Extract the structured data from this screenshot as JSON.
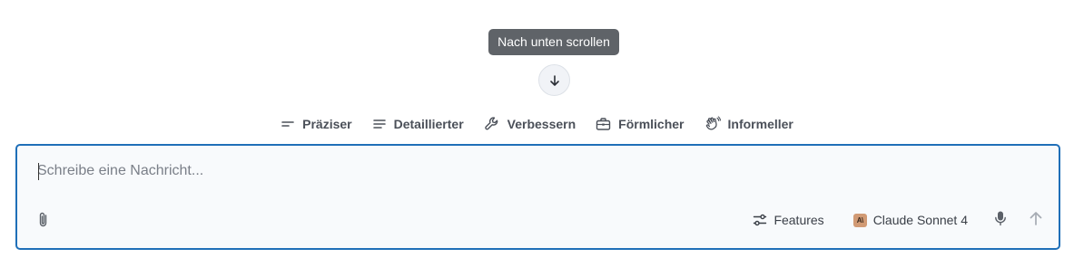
{
  "tooltip": {
    "text": "Nach unten scrollen"
  },
  "scroll_button": {
    "icon": "arrow-down-icon"
  },
  "suggestions": [
    {
      "label": "Präziser",
      "icon": "short-lines-icon"
    },
    {
      "label": "Detaillierter",
      "icon": "paragraph-lines-icon"
    },
    {
      "label": "Verbessern",
      "icon": "wrench-icon"
    },
    {
      "label": "Förmlicher",
      "icon": "briefcase-icon"
    },
    {
      "label": "Informeller",
      "icon": "waving-hand-icon"
    }
  ],
  "composer": {
    "placeholder": "Schreibe eine Nachricht...",
    "value": "",
    "features_label": "Features",
    "model_label": "Claude Sonnet 4",
    "model_badge_text": "A\\"
  },
  "colors": {
    "focus_border": "#1f6fb8",
    "tooltip_bg": "#5f6368",
    "model_badge": "#d19a74"
  }
}
